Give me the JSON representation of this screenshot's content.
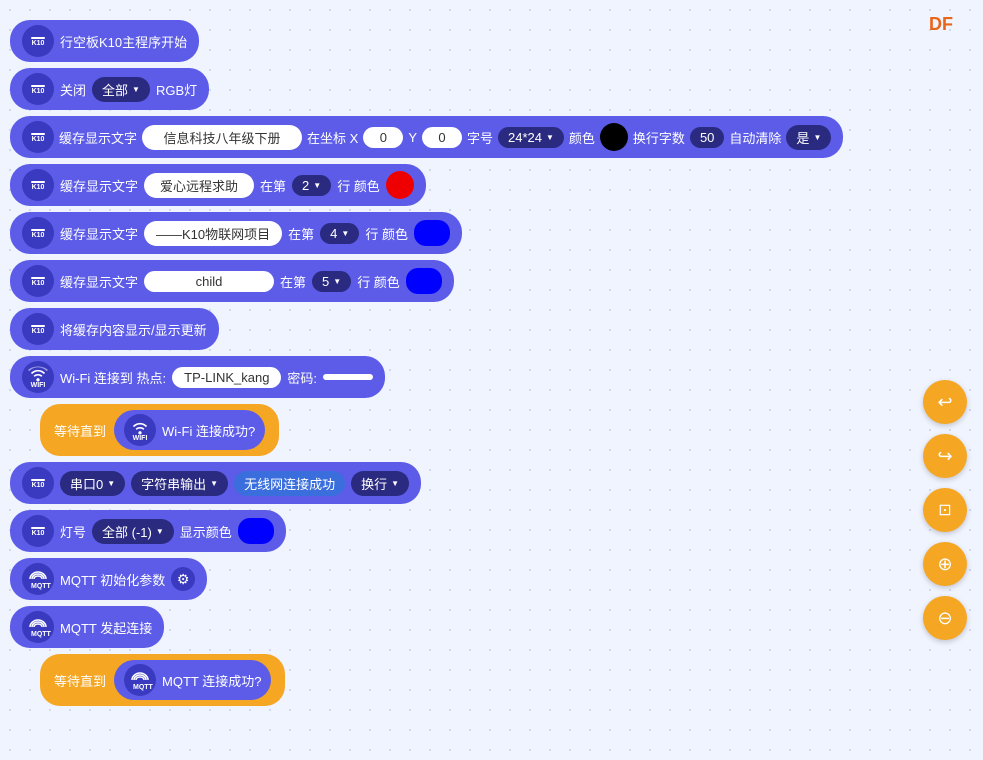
{
  "df_label": "DF",
  "blocks": {
    "start": "行空板K10主程序开始",
    "close_rgb": {
      "prefix": "关闭",
      "dropdown": "全部",
      "suffix": "RGB灯"
    },
    "buffer1": {
      "label": "缓存显示文字",
      "text": "信息科技八年级下册",
      "coord_x_label": "在坐标 X",
      "x_val": "0",
      "y_label": "Y",
      "y_val": "0",
      "font_label": "字号",
      "font_val": "24*24",
      "color_label": "颜色",
      "wrap_label": "换行字数",
      "wrap_val": "50",
      "auto_clear_label": "自动清除",
      "auto_clear_val": "是"
    },
    "buffer2": {
      "label": "缓存显示文字",
      "text": "爱心远程求助",
      "row_label": "在第",
      "row_val": "2",
      "row_suffix": "行 颜色"
    },
    "buffer3": {
      "label": "缓存显示文字",
      "text": "——K10物联网项目",
      "row_label": "在第",
      "row_val": "4",
      "row_suffix": "行 颜色"
    },
    "buffer4": {
      "label": "缓存显示文字",
      "text": "child",
      "row_label": "在第",
      "row_val": "5",
      "row_suffix": "行 颜色"
    },
    "update": "将缓存内容显示/显示更新",
    "wifi_connect": {
      "label": "Wi-Fi 连接到 热点:",
      "ssid": "TP-LINK_kang",
      "pwd_label": "密码:",
      "pwd": " "
    },
    "wait_wifi": {
      "prefix": "等待直到",
      "label": "Wi-Fi 连接成功?"
    },
    "serial": {
      "port": "串口0",
      "output": "字符串输出",
      "text": "无线网连接成功",
      "newline": "换行"
    },
    "light": {
      "label": "灯号",
      "group": "全部 (-1)",
      "suffix": "显示颜色"
    },
    "mqtt_init": "MQTT 初始化参数",
    "mqtt_connect": "MQTT 发起连接",
    "wait_mqtt": {
      "prefix": "等待直到",
      "label": "MQTT 连接成功?"
    }
  },
  "sidebar": {
    "btn_undo": "↩",
    "btn_redo": "↪",
    "btn_crop": "⊡",
    "btn_zoom_in": "⊕",
    "btn_zoom_out": "⊖"
  }
}
